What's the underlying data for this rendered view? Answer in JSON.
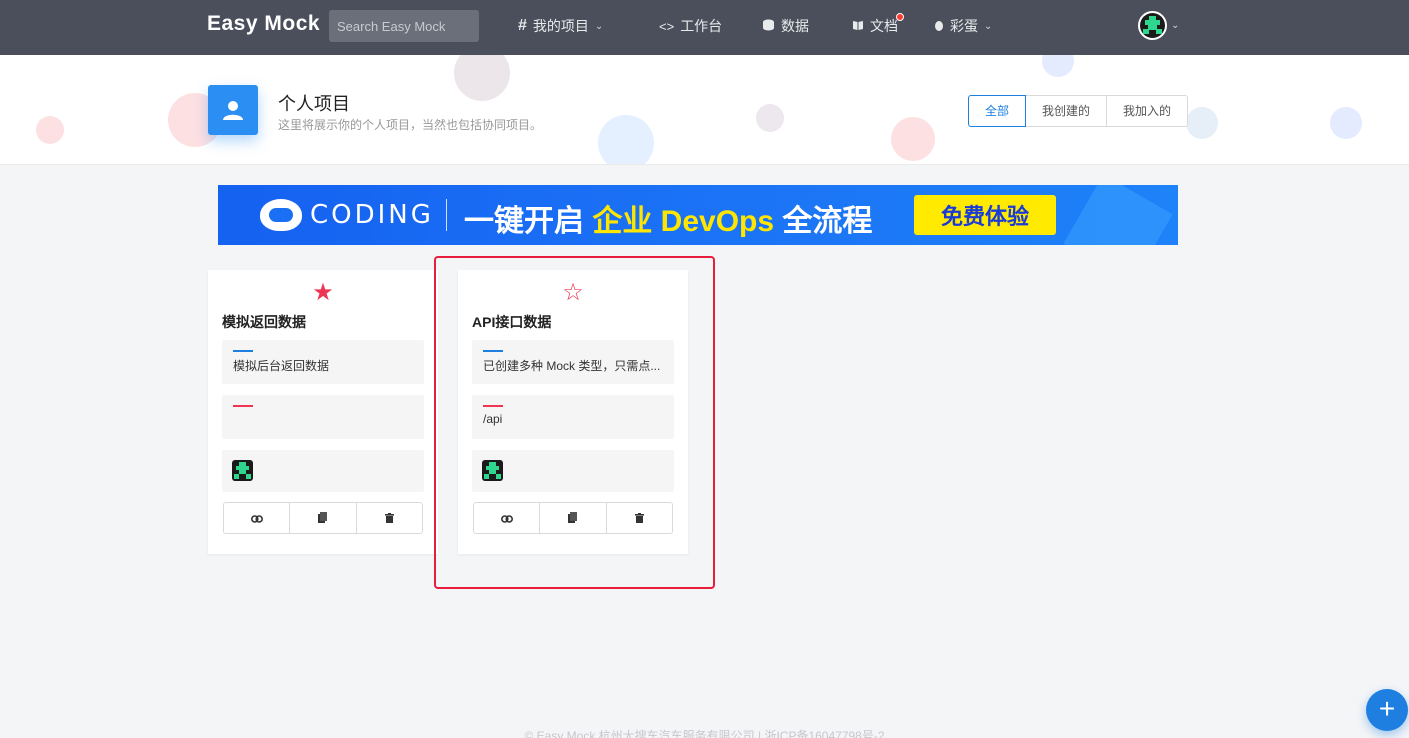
{
  "app": {
    "brand": "Easy Mock",
    "search_placeholder": "Search Easy Mock"
  },
  "nav": {
    "projects": "我的项目",
    "workbench": "工作台",
    "data": "数据",
    "docs": "文档",
    "easter_egg": "彩蛋"
  },
  "header": {
    "title": "个人项目",
    "subtitle": "这里将展示你的个人项目，当然也包括协同项目。",
    "filters": [
      "全部",
      "我创建的",
      "我加入的"
    ],
    "active_filter": "全部"
  },
  "banner": {
    "brand": "CODING",
    "slogan_pre": "一键开启 ",
    "slogan_hl": "企业 DevOps",
    "slogan_post": " 全流程",
    "cta": "免费体验"
  },
  "projects": [
    {
      "starred": true,
      "star_glyph": "★",
      "title": "模拟返回数据",
      "description": "模拟后台返回数据",
      "base_url": ""
    },
    {
      "starred": false,
      "star_glyph": "☆",
      "title": "API接口数据",
      "description": "已创建多种 Mock 类型，只需点...",
      "base_url": "/api"
    }
  ],
  "footer": "© Easy Mock 杭州大搜车汽车服务有限公司 | 浙ICP备16047798号-2",
  "fab_label": "+",
  "colors": {
    "topbar": "#4a4f5b",
    "accent_blue": "#1e7fe0",
    "star_red": "#ee3553",
    "highlight_red": "#ea1c3b",
    "banner_yellow": "#ffea00"
  }
}
